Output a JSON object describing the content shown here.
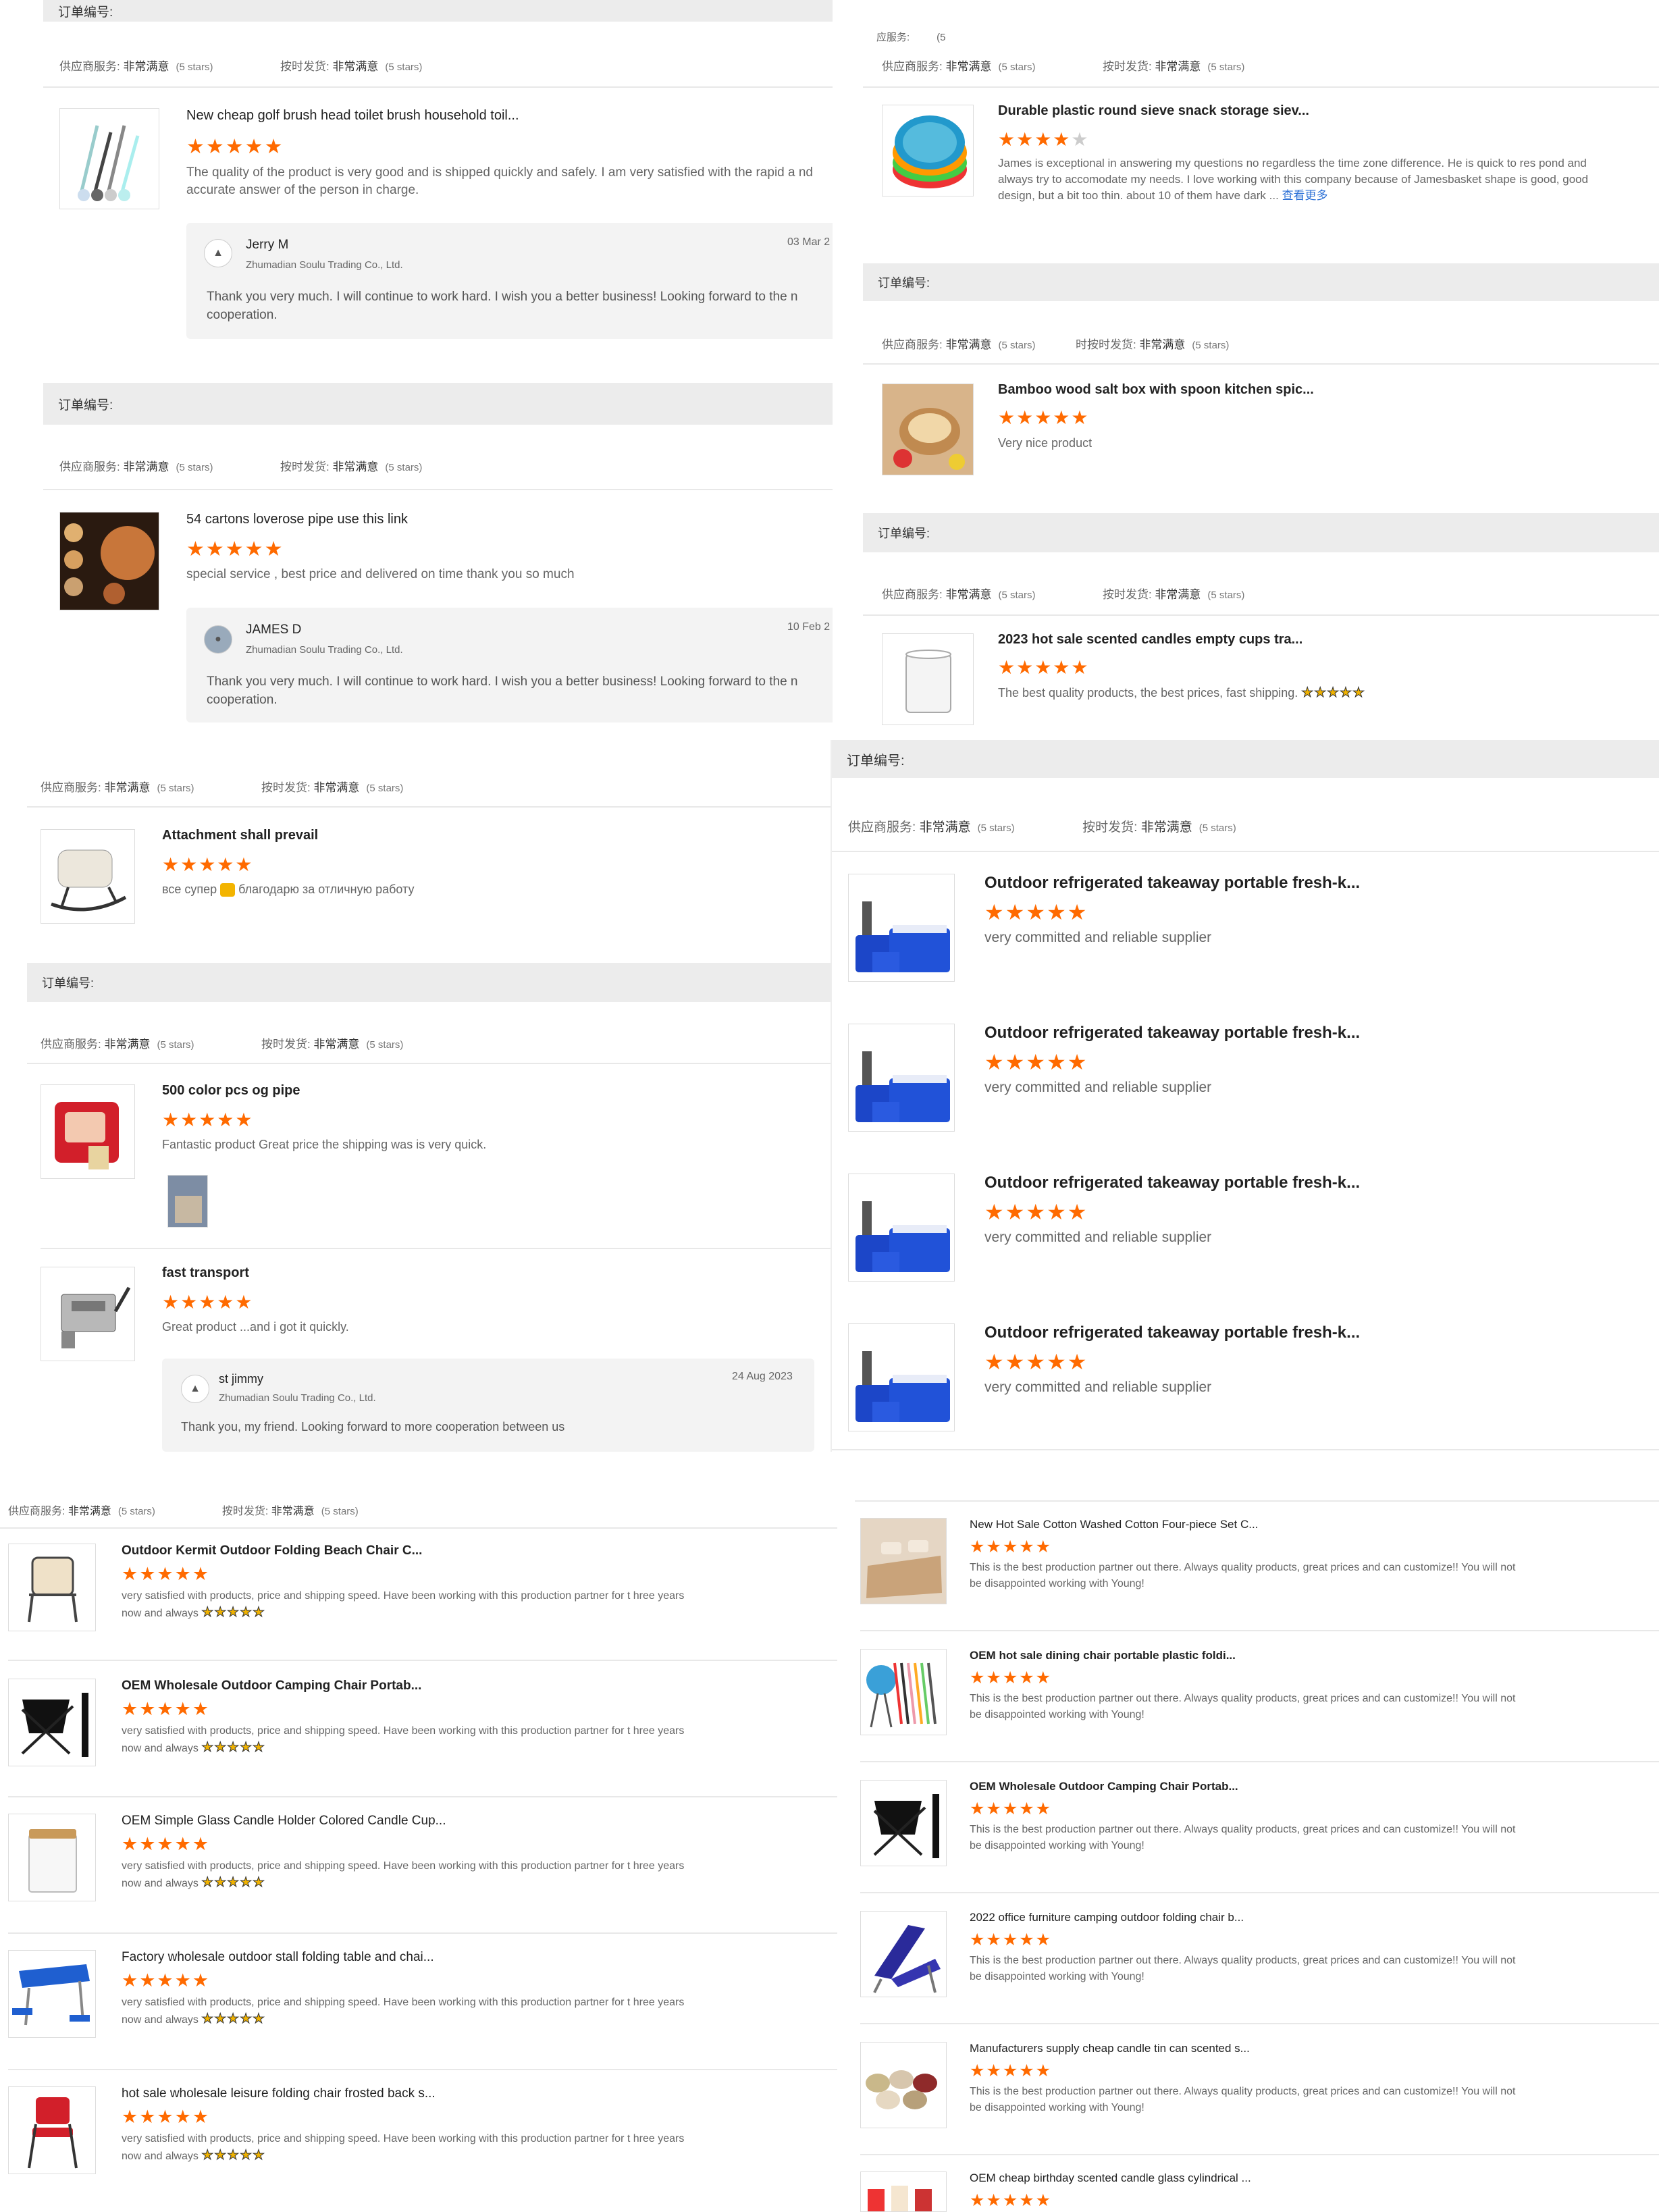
{
  "labels": {
    "order_no": "订单编号:",
    "order_no_alt": "订单编号",
    "supplier_service": "供应商服务:",
    "on_time": "按时发货:",
    "on_time_trunc": "时按时发货:",
    "supplier_trunc": "应服务:",
    "very_satisfied": "非常满意",
    "five_stars": "(5 stars)",
    "see_more": "查看更多",
    "supplier_company": "Zhumadian Soulu Trading Co., Ltd."
  },
  "colors": {
    "star": "#ff6a00",
    "order_bar": "#ececec",
    "link": "#2a6fd6"
  },
  "p1": {
    "review1": {
      "title": "New cheap golf brush head toilet brush household toil...",
      "text": "The quality of the product is very good and is shipped quickly and safely. I am very satisfied with the rapid a nd accurate answer of the person in charge.",
      "reply_name": "Jerry M",
      "reply_date": "03 Mar 2",
      "reply_text": "Thank you very much. I will continue to work hard. I wish you a better business! Looking forward to the n cooperation."
    },
    "review2": {
      "title": "54 cartons loverose pipe use this link",
      "text": "special service , best price and delivered on time thank you so much",
      "reply_name": "JAMES D",
      "reply_date": "10 Feb 2",
      "reply_text": "Thank you very much. I will continue to work hard. I wish you a better business! Looking forward to the n cooperation."
    }
  },
  "p2": {
    "top_frag": "(5",
    "review1": {
      "title": "Durable plastic round sieve snack storage siev...",
      "text": "James is exceptional in answering my questions no regardless the time zone difference. He is quick to res pond and always try to accomodate my needs. I love working with this company because of Jamesbasket shape is good, good design, but a bit too thin. about 10 of them have dark ..."
    },
    "review2": {
      "title": "Bamboo wood salt box with spoon kitchen spic...",
      "text": "Very nice product"
    },
    "review3": {
      "title": "2023 hot sale scented candles empty cups tra...",
      "text": "The best quality products, the best prices, fast shipping."
    }
  },
  "p3": {
    "review1": {
      "title": "Attachment shall prevail",
      "text": "все супер",
      "text2": "благодарю за отличную работу"
    },
    "review2": {
      "title": "500 color pcs og pipe",
      "text": "Fantastic product Great price the shipping was is very quick."
    },
    "review3": {
      "title": "fast transport",
      "text": "Great product ...and i got it quickly.",
      "reply_name": "st jimmy",
      "reply_date": "24 Aug 2023",
      "reply_text": "Thank you, my friend. Looking forward to more cooperation between us"
    }
  },
  "p4": {
    "review_title": "Outdoor refrigerated takeaway portable fresh-k...",
    "review_text": "very committed and reliable supplier"
  },
  "p5": {
    "text": "very satisfied with products, price and shipping speed. Have been working with this production partner for t hree years now and always",
    "titles": [
      "Outdoor Kermit Outdoor Folding Beach Chair C...",
      "OEM Wholesale Outdoor Camping Chair Portab...",
      "OEM Simple Glass Candle Holder Colored Candle Cup...",
      "Factory wholesale outdoor stall folding table and chai...",
      "hot sale wholesale leisure folding chair frosted back s..."
    ]
  },
  "p6": {
    "text": "This is the best production partner out there. Always quality products, great prices and can customize!! You will not be disappointed working with Young!",
    "titles": [
      "New Hot Sale Cotton Washed Cotton Four-piece Set C...",
      "OEM hot sale dining chair portable plastic foldi...",
      "OEM Wholesale Outdoor Camping Chair Portab...",
      "2022 office furniture camping outdoor folding chair b...",
      "Manufacturers supply cheap candle tin can scented s...",
      "OEM cheap birthday scented candle glass cylindrical ..."
    ]
  },
  "stars": {
    "five": "★★★★★",
    "four": "★★★★",
    "one_off": "★"
  }
}
